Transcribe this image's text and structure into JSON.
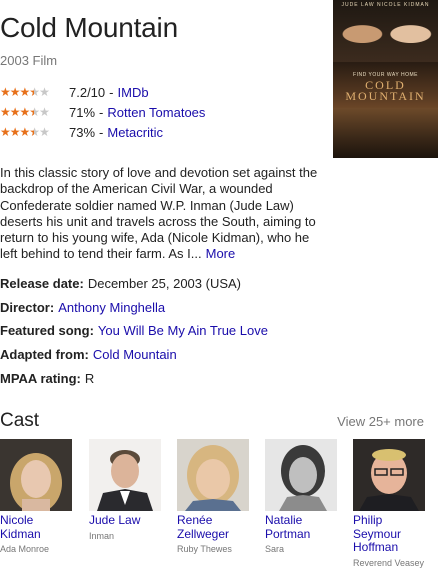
{
  "title": "Cold Mountain",
  "subtitle": "2003 Film",
  "poster": {
    "top_names": "JUDE LAW  NICOLE KIDMAN",
    "tagline": "FIND YOUR WAY HOME",
    "title_text": "COLD MOUNTAIN"
  },
  "ratings": [
    {
      "score": "7.2/10",
      "source": "IMDb",
      "stars": 3.5
    },
    {
      "score": "71%",
      "source": "Rotten Tomatoes",
      "stars": 3.5
    },
    {
      "score": "73%",
      "source": "Metacritic",
      "stars": 3.5
    }
  ],
  "description": {
    "text": "In this classic story of love and devotion set against the backdrop of the American Civil War, a wounded Confederate soldier named W.P. Inman (Jude Law) deserts his unit and travels across the South, aiming to return to his young wife, Ada (Nicole Kidman), who he left behind to tend their farm. As I...",
    "more_label": "More"
  },
  "facts": [
    {
      "label": "Release date:",
      "value": "December 25, 2003 (USA)",
      "is_link": false
    },
    {
      "label": "Director:",
      "value": "Anthony Minghella",
      "is_link": true
    },
    {
      "label": "Featured song:",
      "value": "You Will Be My Ain True Love",
      "is_link": true
    },
    {
      "label": "Adapted from:",
      "value": "Cold Mountain",
      "is_link": true
    },
    {
      "label": "MPAA rating:",
      "value": "R",
      "is_link": false
    }
  ],
  "cast": {
    "title": "Cast",
    "view_more": "View 25+ more",
    "members": [
      {
        "name": "Nicole Kidman",
        "role": "Ada Monroe"
      },
      {
        "name": "Jude Law",
        "role": "Inman"
      },
      {
        "name": "Renée Zellweger",
        "role": "Ruby Thewes"
      },
      {
        "name": "Natalie Portman",
        "role": "Sara"
      },
      {
        "name": "Philip Seymour Hoffman",
        "role": "Reverend Veasey"
      }
    ]
  },
  "colors": {
    "link": "#1a0dab",
    "star": "#e7711b",
    "muted": "#777777"
  }
}
